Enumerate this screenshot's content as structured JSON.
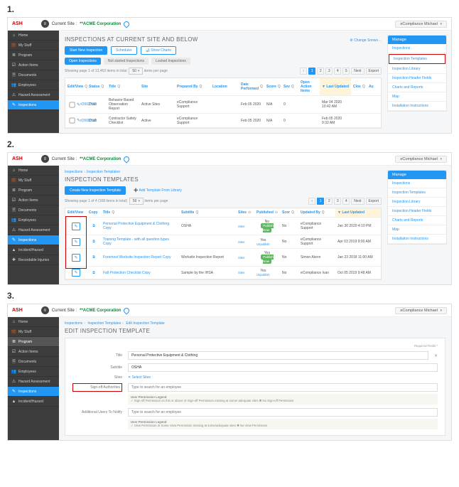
{
  "topbar": {
    "logo": "ASH",
    "site_label": "Current Site :",
    "site_name": "**ACME Corporation",
    "user": "eCompliance Michael"
  },
  "sidebar": [
    {
      "icon": "⌂",
      "label": "Home"
    },
    {
      "icon": "💼",
      "label": "My Stuff"
    },
    {
      "icon": "≣",
      "label": "Program"
    },
    {
      "icon": "☑",
      "label": "Action Items"
    },
    {
      "icon": "🗎",
      "label": "Documents"
    },
    {
      "icon": "👥",
      "label": "Employees"
    },
    {
      "icon": "⚠",
      "label": "Hazard Assessment"
    },
    {
      "icon": "✎",
      "label": "Inspections"
    },
    {
      "icon": "▲",
      "label": "Incident/Hazard"
    },
    {
      "icon": "✚",
      "label": "Recordable Injuries"
    }
  ],
  "manage": {
    "header": "Manage",
    "items": [
      "Inspections",
      "Inspection Templates",
      "Inspection Library",
      "Inspection Header Fields",
      "Charts and Reports",
      "Map",
      "Installation Instructions"
    ]
  },
  "s1": {
    "title": "INSPECTIONS AT CURRENT SITE AND BELOW",
    "change": "⚙ Change Snows…",
    "btn_start": "Start New Inspection",
    "btn_sched": "Scheduler",
    "btn_charts": "📊 Show Charts",
    "tabs": [
      "Open Inspections",
      "Not started Inspections",
      "Locked Inspections"
    ],
    "show_text": "Showing page 1 of 13,462 items in total",
    "perpage": "50",
    "perpage_suffix": "items per page",
    "pager": [
      "1",
      "2",
      "3",
      "4",
      "5",
      "Next",
      "Export"
    ],
    "headers": {
      "ev": "Edit/View",
      "st": "Status",
      "ti": "Title",
      "si": "Site",
      "pr": "Prepared By",
      "lo": "Location",
      "dt": "Date Performed",
      "sc": "Score",
      "sv": "Sev",
      "op": "Open Action Items",
      "up": "▼ Last Updated",
      "cl": "Clos",
      "au": "Au"
    },
    "q": "Q",
    "rows": [
      {
        "id": "#2602731",
        "status": "Draft",
        "title": "Behavior Based Observation Report",
        "site": "Active Sites",
        "prep": "eCompliance Support",
        "date": "Feb 05 2020",
        "score": "N/A",
        "sev": "0",
        "upd": "Mar 04 2020 10:42 AM"
      },
      {
        "id": "#2600713",
        "status": "Draft",
        "title": "Contractor Safety Checklist",
        "site": "Active",
        "prep": "eCompliance Support",
        "date": "Feb 05 2020",
        "score": "N/A",
        "sev": "0",
        "upd": "Feb 05 2020 9:32 AM"
      }
    ]
  },
  "s2": {
    "crumb1": "Inspections",
    "crumb2": "Inspection Templates",
    "title": "INSPECTION TEMPLATES",
    "btn_create": "Create New Inspection Template",
    "btn_lib": "➕ Add Template From Library",
    "show_text": "Showing page 1 of 4 (168 items in total)",
    "perpage": "50",
    "perpage_suffix": "items per page",
    "pager": [
      "1",
      "2",
      "3",
      "4",
      "Next",
      "Export"
    ],
    "headers": {
      "ev": "Edit/View",
      "cp": "Copy",
      "ti": "Title",
      "su": "Subtitle",
      "si": "Sites",
      "pu": "Published",
      "sc": "Scor",
      "ub": "Updated By",
      "up": "▼ Last Updated"
    },
    "q": "Q",
    "circle": "⊙",
    "rows": [
      {
        "title": "Personal Protective Equipment & Clothing Copy",
        "sub": "OSHA",
        "pubYes": "No",
        "badge": "Publish Now",
        "score": "No",
        "by": "eCompliance Support",
        "upd": "Jan 30 2020 4:10 PM"
      },
      {
        "title": "Training Template - with all question types Copy",
        "sub": "",
        "pubYes": "Yes",
        "under": "Unpublish",
        "score": "No",
        "by": "eCompliance Support",
        "upd": "Apr 03 2019 9:00 AM"
      },
      {
        "title": "Foremost Worksite Inspection Report Copy",
        "sub": "Worksite Inspection Report",
        "pubYes": "Yes",
        "badge": "Publish Now",
        "score": "No",
        "by": "Simon Akere",
        "upd": "Jan 23 2018 11:00 AM"
      },
      {
        "title": "Fall Protection Checklist Copy",
        "sub": "Sample by the IHSA",
        "pubYes": "Yes",
        "under": "Unpublish",
        "score": "No",
        "by": "eCompliance Ivan",
        "upd": "Oct 05 2019 9:48 AM"
      }
    ],
    "sites_link": "Sites"
  },
  "s3": {
    "crumb1": "Inspections",
    "crumb2": "Inspection Templates",
    "crumb3": "Edit Inspection Template",
    "title": "EDIT INSPECTION TEMPLATE",
    "req": "Required Fields *",
    "labels": {
      "title": "Title",
      "sub": "Subtitle",
      "sites": "Sites",
      "signoff": "Sign-off Authorities",
      "addl": "Additional Users To Notify"
    },
    "vals": {
      "title": "Personal Protective Equipment & Clothing",
      "sub": "OSHA",
      "sites": "✕ Select Sites",
      "ph": "Type to search for an employee"
    },
    "legend_hdr": "User Permission Legend",
    "legend1": "✓ Sign-off Permission on this or above  ⊘ Sign-off Permission missing at some/ adequate sites  ✖ No Sign-off Permission",
    "legend2": "✓ View Permission  ⊘ Some View Permission missing at some/adequate sites  ✖ No View Permission"
  }
}
